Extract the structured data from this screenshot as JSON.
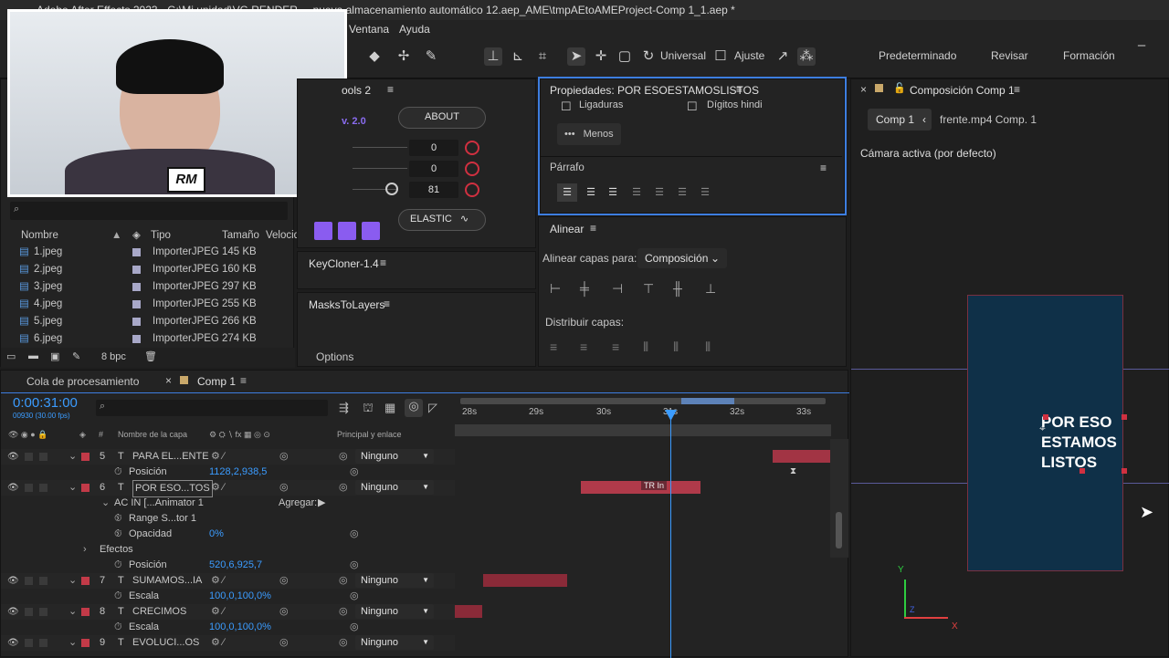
{
  "window": {
    "title": "Adobe After Effects 2023 - G:\\Mi unidad\\VG RENDER ... nueva almacenamiento automático 12.aep_AME\\tmpAEtoAMEProject-Comp 1_1.aep *"
  },
  "menu": {
    "items": [
      "Ventana",
      "Ayuda"
    ]
  },
  "toolbar": {
    "universal_label": "Universal",
    "ajuste_label": "Ajuste",
    "workspaces": [
      "Predeterminado",
      "Revisar",
      "Formación"
    ]
  },
  "webcam": {
    "badge": "RM"
  },
  "project": {
    "search_placeholder": "",
    "columns": [
      "Nombre",
      "Tipo",
      "Tamaño",
      "Velocid"
    ],
    "files": [
      {
        "name": "1.jpeg",
        "type": "ImporterJPEG",
        "size": "145 KB"
      },
      {
        "name": "2.jpeg",
        "type": "ImporterJPEG",
        "size": "160 KB"
      },
      {
        "name": "3.jpeg",
        "type": "ImporterJPEG",
        "size": "297 KB"
      },
      {
        "name": "4.jpeg",
        "type": "ImporterJPEG",
        "size": "255 KB"
      },
      {
        "name": "5.jpeg",
        "type": "ImporterJPEG",
        "size": "266 KB"
      },
      {
        "name": "6.jpeg",
        "type": "ImporterJPEG",
        "size": "274 KB"
      }
    ],
    "bpc": "8 bpc"
  },
  "tools_panel": {
    "title": "ools 2",
    "version": "v. 2.0",
    "about": "ABOUT",
    "values": [
      "0",
      "0",
      "81"
    ],
    "elastic": "ELASTIC"
  },
  "keycloner": {
    "title": "KeyCloner-1.4"
  },
  "maskstolayers": {
    "title": "MasksToLayers",
    "options": "Options"
  },
  "properties": {
    "title": "Propiedades: POR ESOESTAMOSLISTOS",
    "ligaduras": "Ligaduras",
    "digitos": "Dígitos hindi",
    "menos": "Menos",
    "parrafo": "Párrafo"
  },
  "alinear": {
    "title": "Alinear",
    "align_to_label": "Alinear capas para:",
    "align_to_value": "Composición",
    "distribute": "Distribuir capas:"
  },
  "composition": {
    "tab": "Composición Comp 1",
    "crumbs": [
      "Comp 1",
      "frente.mp4 Comp. 1"
    ],
    "camera": "Cámara activa (por defecto)",
    "text_lines": [
      "POR ESO",
      "ESTAMOS",
      "LISTOS"
    ],
    "bg_color": "#0f3048"
  },
  "timeline": {
    "tab_queue": "Cola de procesamiento",
    "tab_comp": "Comp 1",
    "timecode": "0:00:31:00",
    "fps": "00930 (30.00 fps)",
    "col_name": "Nombre de la capa",
    "col_parent": "Principal y enlace",
    "ruler": [
      "28s",
      "29s",
      "30s",
      "31s",
      "32s",
      "33s"
    ],
    "rows": [
      {
        "num": "5",
        "type": "T",
        "name": "PARA EL...ENTE",
        "parent": "Ninguno"
      },
      {
        "prop": "Posición",
        "value": "1128,2,938,5"
      },
      {
        "num": "6",
        "type": "T",
        "name": "POR ESO...TOS",
        "parent": "Ninguno"
      },
      {
        "group": "AC IN [...Animator 1",
        "agregar": "Agregar:"
      },
      {
        "prop": "Range S...tor 1"
      },
      {
        "prop": "Opacidad",
        "value": "0%"
      },
      {
        "group": "Efectos"
      },
      {
        "prop": "Posición",
        "value": "520,6,925,7"
      },
      {
        "num": "7",
        "type": "T",
        "name": "SUMAMOS...IA",
        "parent": "Ninguno"
      },
      {
        "prop": "Escala",
        "value": "100,0,100,0%"
      },
      {
        "num": "8",
        "type": "T",
        "name": "CRECIMOS",
        "parent": "Ninguno"
      },
      {
        "prop": "Escala",
        "value": "100,0,100,0%"
      },
      {
        "num": "9",
        "type": "T",
        "name": "EVOLUCI...OS",
        "parent": "Ninguno"
      }
    ],
    "clip_label": "TR In"
  },
  "colors": {
    "accent": "#3d7ee0",
    "label_red": "#c23a48",
    "timecode": "#3b9cff"
  }
}
